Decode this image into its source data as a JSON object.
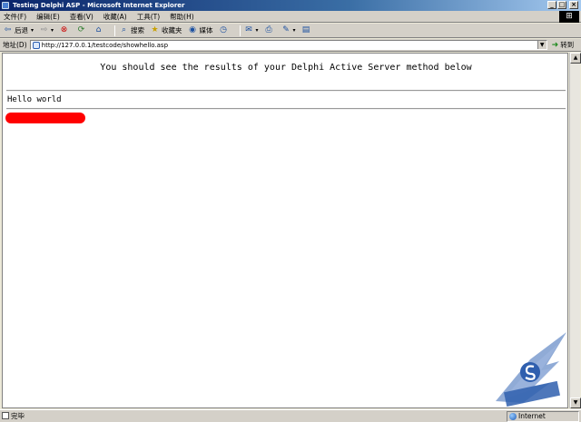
{
  "window": {
    "title": "Testing Delphi ASP - Microsoft Internet Explorer",
    "min_label": "_",
    "max_label": "□",
    "close_label": "×"
  },
  "menu": {
    "items": [
      "文件(F)",
      "编辑(E)",
      "查看(V)",
      "收藏(A)",
      "工具(T)",
      "帮助(H)"
    ]
  },
  "toolbar": {
    "back_label": "后退",
    "search_label": "搜索",
    "favorites_label": "收藏夹",
    "media_label": "媒体"
  },
  "address": {
    "label": "地址(D)",
    "url": "http://127.0.0.1/testcode/showhello.asp",
    "go_label": "转到"
  },
  "content": {
    "heading": "You should see the results of your Delphi Active Server method below",
    "result_text": "Hello world"
  },
  "status": {
    "text": "完毕",
    "zone": "Internet"
  },
  "colors": {
    "redaction": "#ff0000",
    "title_gradient_start": "#0a246a"
  }
}
